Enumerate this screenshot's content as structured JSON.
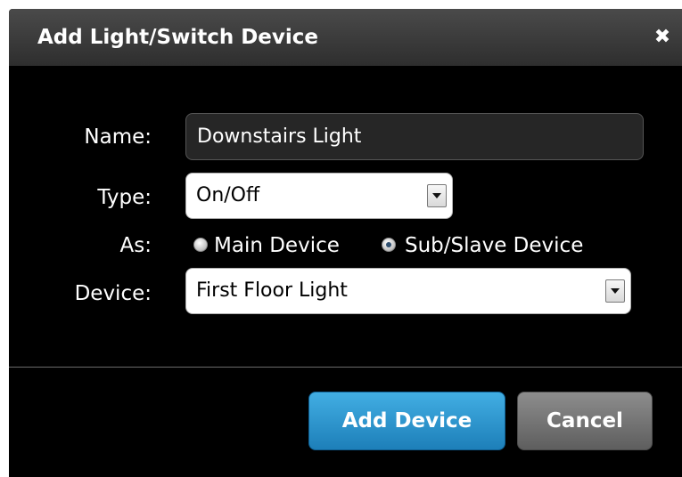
{
  "dialog": {
    "title": "Add Light/Switch Device",
    "close_icon": "close-icon"
  },
  "form": {
    "name_label": "Name:",
    "name_value": "Downstairs Light",
    "type_label": "Type:",
    "type_value": "On/Off",
    "as_label": "As:",
    "as_options": [
      {
        "label": "Main Device",
        "checked": false
      },
      {
        "label": "Sub/Slave Device",
        "checked": true
      }
    ],
    "device_label": "Device:",
    "device_value": "First Floor Light"
  },
  "buttons": {
    "add_label": "Add Device",
    "cancel_label": "Cancel"
  },
  "colors": {
    "primary_button": "#2a93cf",
    "secondary_button": "#707070",
    "dialog_background": "#000000"
  }
}
